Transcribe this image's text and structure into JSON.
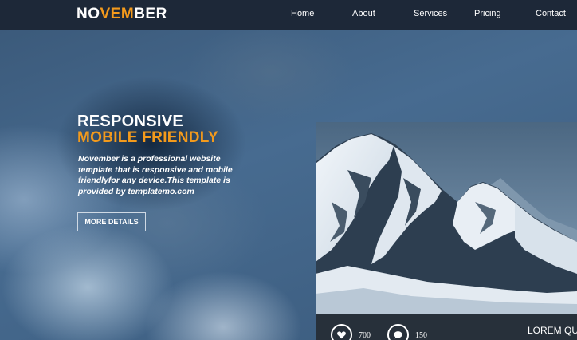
{
  "header": {
    "logo": {
      "part1": "NO",
      "part2": "VEM",
      "part3": "BER"
    },
    "nav": [
      "Home",
      "About",
      "Services",
      "Pricing",
      "Contact"
    ]
  },
  "hero": {
    "title_line1": "RESPONSIVE",
    "title_line2": "MOBILE FRIENDLY",
    "description": "November is a professional website template that is responsive and mobile friendlyfor any device.This template is provided by templatemo.com",
    "button_label": "MORE DETAILS"
  },
  "card": {
    "likes": "700",
    "comments": "150",
    "caption": "LOREM QU"
  },
  "colors": {
    "accent": "#f39a1c",
    "header_bg": "#1d2838",
    "card_bar": "#27303a"
  },
  "icons": [
    "heart-icon",
    "comment-icon"
  ]
}
